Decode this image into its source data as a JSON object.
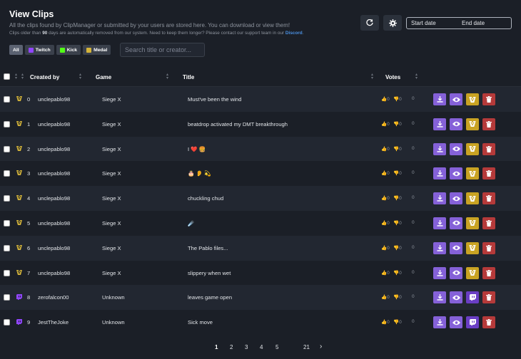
{
  "header": {
    "title": "View Clips",
    "subtitle": "All the clips found by ClipManager or submitted by your users are stored here. You can download or view them!",
    "retention_prefix": "Clips older than ",
    "retention_days": "90",
    "retention_suffix": " days are automatically removed from our system. Need to keep them longer? Please contact our support team in our ",
    "discord_link": "Discord",
    "retention_end": "."
  },
  "toolbar": {
    "refresh_icon": "refresh-icon",
    "settings_icon": "gear-icon",
    "start_date": "Start date",
    "end_date": "End date"
  },
  "filters": {
    "all": "All",
    "twitch": "Twitch",
    "kick": "Kick",
    "medal": "Medal"
  },
  "search": {
    "placeholder": "Search title or creator..."
  },
  "table": {
    "headers": {
      "created_by": "Created by",
      "game": "Game",
      "title": "Title",
      "votes": "Votes"
    },
    "rows": [
      {
        "idx": "0",
        "platform": "medal",
        "creator": "unclepablo98",
        "game": "Siege X",
        "title": "Must've been the wind",
        "up": "0",
        "down": "0",
        "score": "0"
      },
      {
        "idx": "1",
        "platform": "medal",
        "creator": "unclepablo98",
        "game": "Siege X",
        "title": "beatdrop activated my DMT breakthrough",
        "up": "0",
        "down": "0",
        "score": "0"
      },
      {
        "idx": "2",
        "platform": "medal",
        "creator": "unclepablo98",
        "game": "Siege X",
        "title": "I ❤️ 🍔",
        "up": "0",
        "down": "0",
        "score": "0"
      },
      {
        "idx": "3",
        "platform": "medal",
        "creator": "unclepablo98",
        "game": "Siege X",
        "title": "🎂 👂 💫",
        "up": "0",
        "down": "0",
        "score": "0"
      },
      {
        "idx": "4",
        "platform": "medal",
        "creator": "unclepablo98",
        "game": "Siege X",
        "title": "chuckling chud",
        "up": "0",
        "down": "0",
        "score": "0"
      },
      {
        "idx": "5",
        "platform": "medal",
        "creator": "unclepablo98",
        "game": "Siege X",
        "title": "☄️",
        "up": "0",
        "down": "0",
        "score": "0"
      },
      {
        "idx": "6",
        "platform": "medal",
        "creator": "unclepablo98",
        "game": "Siege X",
        "title": "The Pablo files...",
        "up": "0",
        "down": "0",
        "score": "0"
      },
      {
        "idx": "7",
        "platform": "medal",
        "creator": "unclepablo98",
        "game": "Siege X",
        "title": "slippery when wet",
        "up": "0",
        "down": "0",
        "score": "0"
      },
      {
        "idx": "8",
        "platform": "twitch",
        "creator": "zerofalcon00",
        "game": "Unknown",
        "title": "leaves game open",
        "up": "0",
        "down": "0",
        "score": "0"
      },
      {
        "idx": "9",
        "platform": "twitch",
        "creator": "JestTheJoke",
        "game": "Unknown",
        "title": "Sick move",
        "up": "0",
        "down": "0",
        "score": "0"
      }
    ]
  },
  "pagination": {
    "pages": [
      "1",
      "2",
      "3",
      "4",
      "5"
    ],
    "last": "21",
    "next": "›",
    "current": "1"
  },
  "colors": {
    "accent_purple": "#8561d8",
    "medal_gold": "#c9a323",
    "twitch_purple": "#6a3ec4",
    "danger_red": "#b53a3a",
    "background": "#1b1f27"
  }
}
